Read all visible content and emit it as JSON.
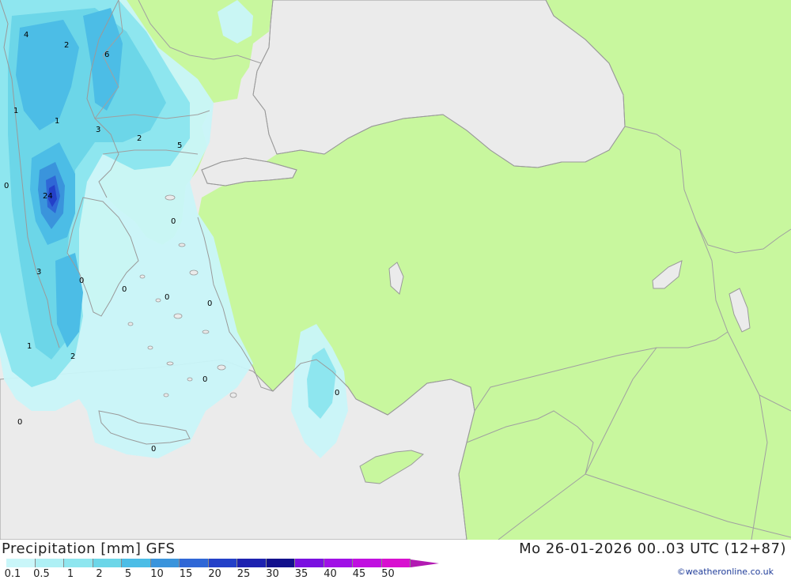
{
  "title": "Precipitation [mm] GFS",
  "datetime": "Mo 26-01-2026 00..03 UTC (12+87)",
  "credit": "©weatheronline.co.uk",
  "colors": {
    "sea": "#ebebeb",
    "land": "#c8f79e",
    "border": "#a0a0a0",
    "coast": "#9a9a9a"
  },
  "legend": {
    "labels": [
      "0.1",
      "0.5",
      "1",
      "2",
      "5",
      "10",
      "15",
      "20",
      "25",
      "30",
      "35",
      "40",
      "45",
      "50"
    ],
    "colors": [
      "#c9f6f9",
      "#aef0f5",
      "#8ee6ef",
      "#6cd6e8",
      "#4cbde6",
      "#3a94dc",
      "#2f67d6",
      "#2340c8",
      "#1d22b0",
      "#12108c",
      "#7a10e0",
      "#a010e6",
      "#c010e0",
      "#d810d0"
    ],
    "arrow_color": "#b21ab2"
  },
  "map_values": [
    "4",
    "2",
    "6",
    "1",
    "1",
    "3",
    "2",
    "5",
    "0",
    "24",
    "0",
    "3",
    "0",
    "0",
    "0",
    "0",
    "1",
    "2",
    "0",
    "0",
    "0",
    "0"
  ]
}
